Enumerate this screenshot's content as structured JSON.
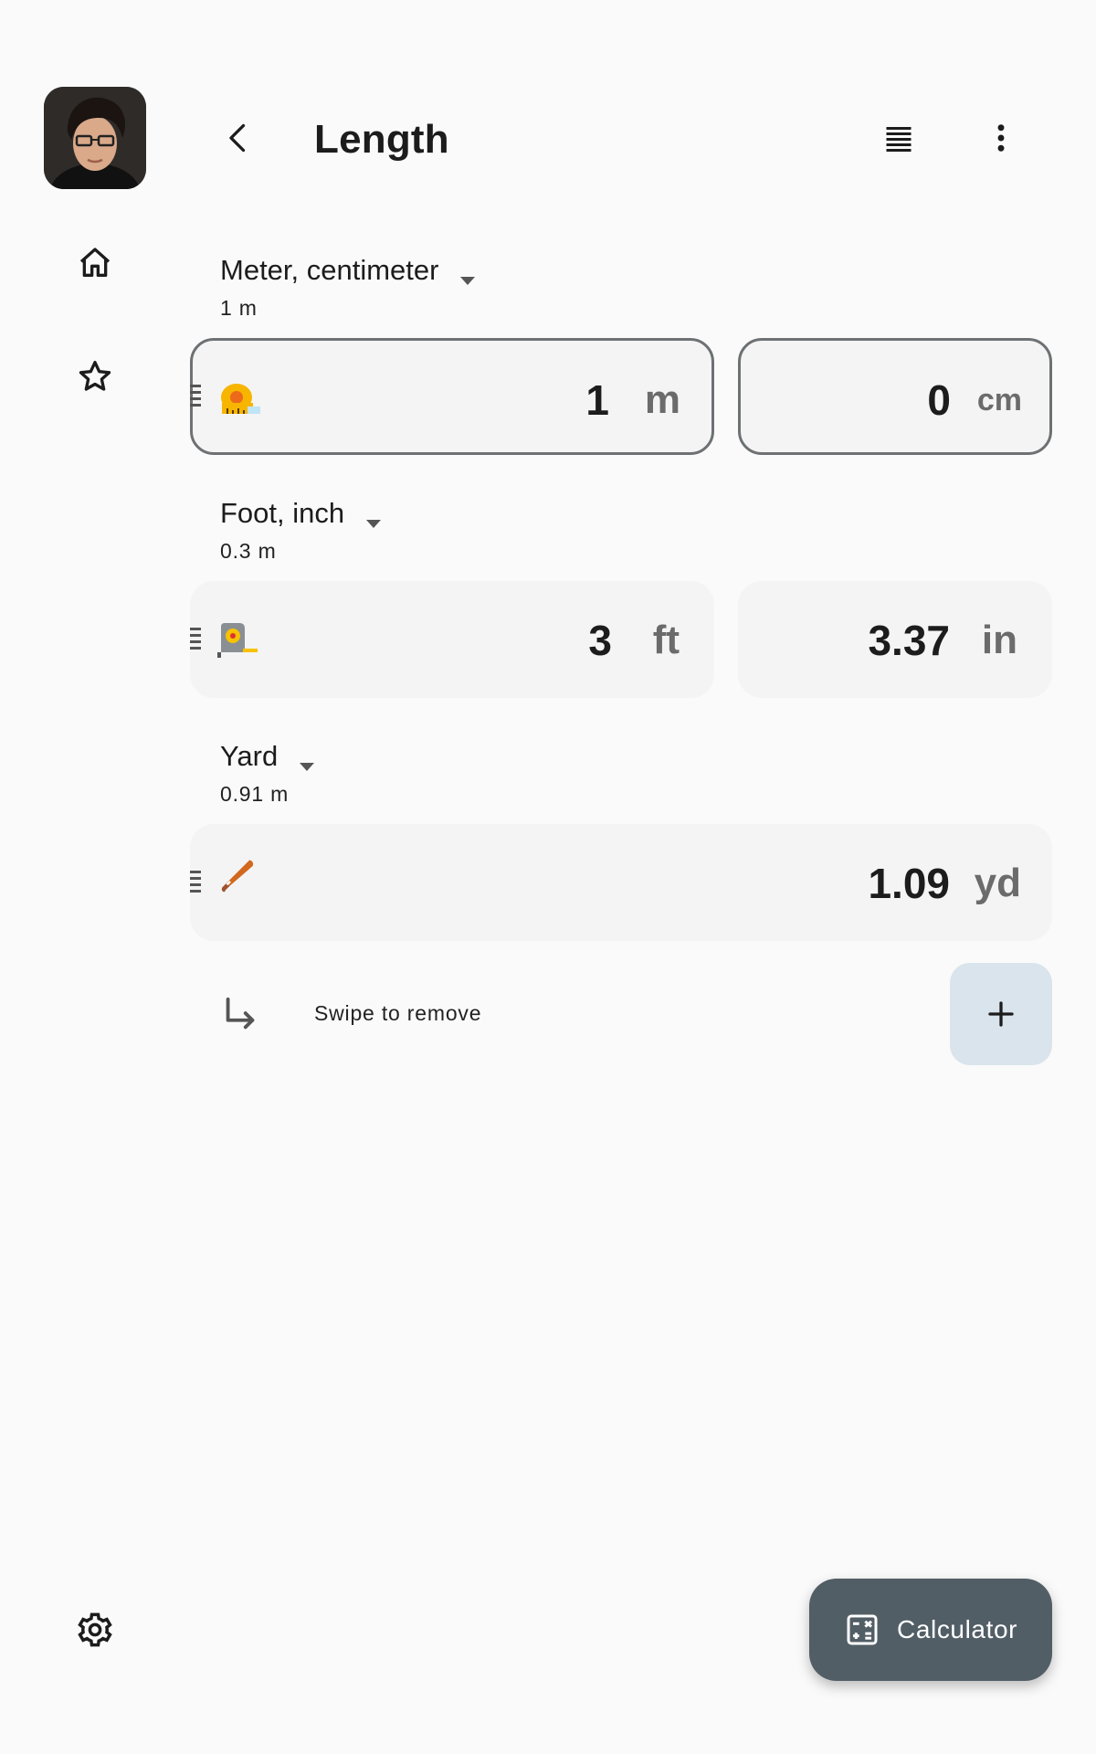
{
  "header": {
    "title": "Length"
  },
  "rail": {
    "avatar_alt": "User avatar"
  },
  "units": [
    {
      "name": "Meter, centimeter",
      "sub": "1 m",
      "fields": [
        {
          "value": "1",
          "unit": "m"
        },
        {
          "value": "0",
          "unit": "cm"
        }
      ]
    },
    {
      "name": "Foot, inch",
      "sub": "0.3 m",
      "fields": [
        {
          "value": "3",
          "unit": "ft"
        },
        {
          "value": "3.37",
          "unit": "in"
        }
      ]
    },
    {
      "name": "Yard",
      "sub": "0.91 m",
      "fields": [
        {
          "value": "1.09",
          "unit": "yd"
        }
      ]
    }
  ],
  "hint": {
    "text": "Swipe to remove"
  },
  "fab": {
    "label": "Calculator"
  },
  "icons": [
    "home-icon",
    "star-icon",
    "settings-icon",
    "back-icon",
    "list-icon",
    "more-vert-icon",
    "return-arrow-icon",
    "add-icon",
    "calculator-icon",
    "tape-measure-icon",
    "measuring-tape-icon",
    "bat-icon"
  ],
  "colors": {
    "fab_bg": "#525e66",
    "add_bg": "#d9e4ec",
    "field_bg": "#f4f4f4",
    "outline": "#6e7173"
  }
}
